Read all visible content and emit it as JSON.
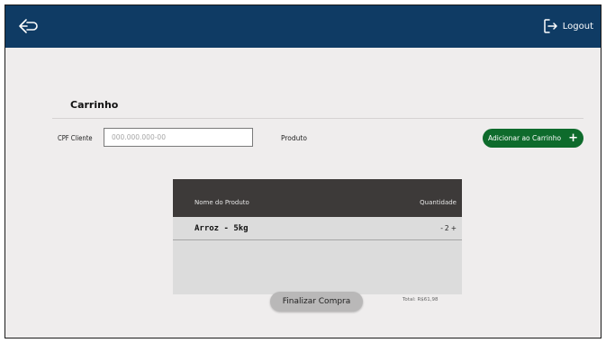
{
  "header": {
    "back_icon": "arrow-back-icon",
    "logout_label": "Logout",
    "logout_icon": "logout-icon",
    "bg_color": "#0f3b64"
  },
  "cart": {
    "title": "Carrinho",
    "cpf_label": "CPF Cliente",
    "cpf_placeholder": "000.000.000-00",
    "produto_label": "Produto",
    "add_button_label": "Adicionar ao Carrinho",
    "add_button_color": "#0e6b2c"
  },
  "table": {
    "headers": {
      "name": "Nome do Produto",
      "quantity": "Quantidade"
    },
    "rows": [
      {
        "name": "Arroz - 5kg",
        "qty_minus": "-",
        "qty": "2",
        "qty_plus": "+"
      }
    ]
  },
  "footer": {
    "total_label": "Total: R$61,98",
    "finalize_label": "Finalizar Compra"
  }
}
